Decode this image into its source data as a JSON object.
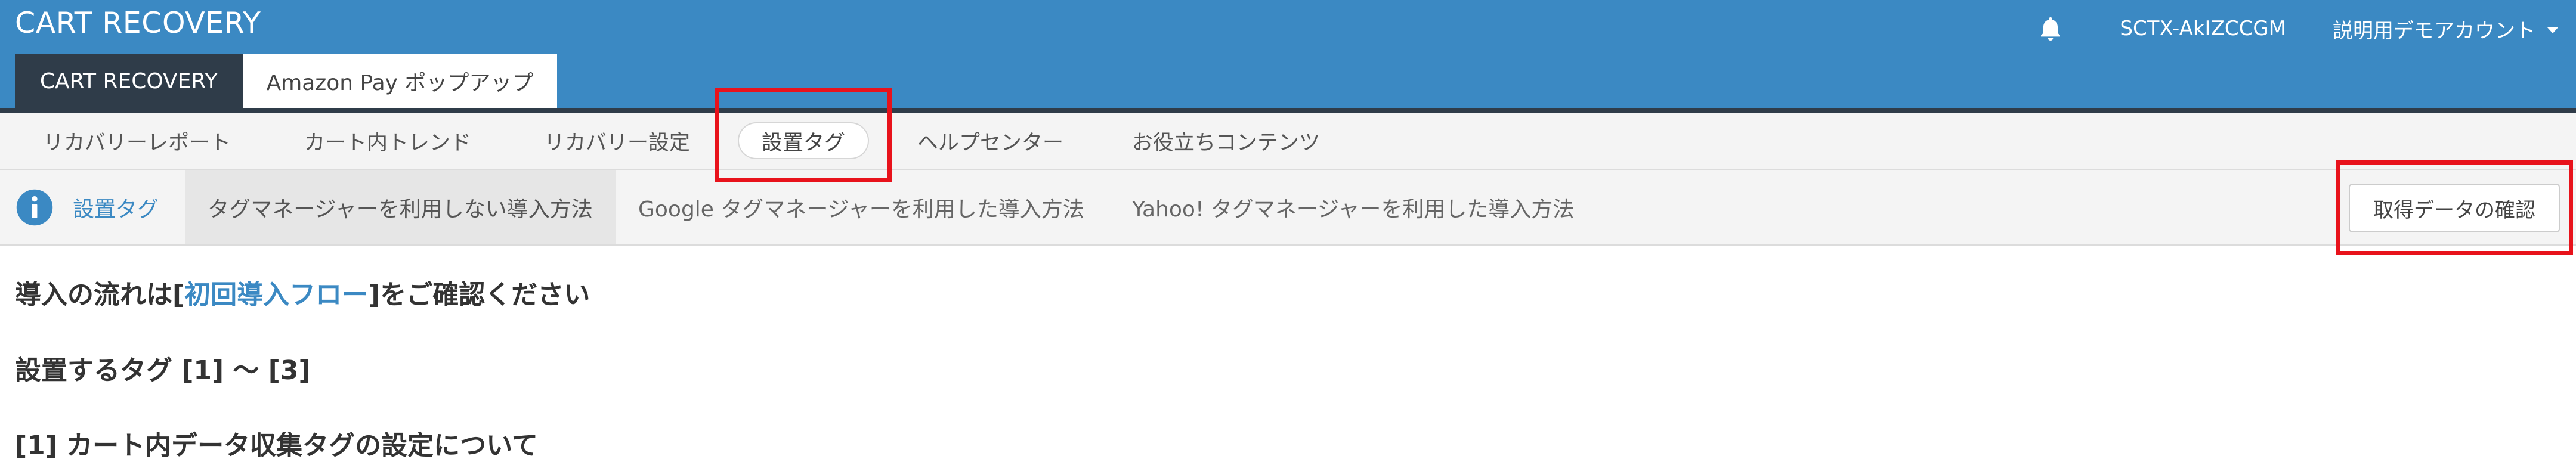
{
  "header": {
    "logo": "CART RECOVERY",
    "account_id": "SCTX-AkIZCCGM",
    "account_name": "説明用デモアカウント"
  },
  "top_tabs": [
    {
      "label": "CART RECOVERY",
      "active": true
    },
    {
      "label": "Amazon Pay ポップアップ",
      "active": false
    }
  ],
  "subnav": {
    "items": [
      {
        "label": "リカバリーレポート"
      },
      {
        "label": "カート内トレンド"
      },
      {
        "label": "リカバリー設定"
      },
      {
        "label": "設置タグ",
        "active": true
      },
      {
        "label": "ヘルプセンター"
      },
      {
        "label": "お役立ちコンテンツ"
      }
    ]
  },
  "infobar": {
    "label": "設置タグ",
    "methods": [
      {
        "label": "タグマネージャーを利用しない導入方法",
        "active": true
      },
      {
        "label": "Google タグマネージャーを利用した導入方法"
      },
      {
        "label": "Yahoo! タグマネージャーを利用した導入方法"
      }
    ],
    "confirm_button": "取得データの確認"
  },
  "content": {
    "flow_prefix": "導入の流れは[",
    "flow_link": "初回導入フロー",
    "flow_suffix": "]をご確認ください",
    "tags_heading": "設置するタグ [1] ～ [3]",
    "section_1_heading": "[1] カート内データ収集タグの設定について"
  },
  "colors": {
    "header_blue": "#3b89c3",
    "dark_navy": "#2f3c49",
    "highlight_red": "#e8121b",
    "link_blue": "#3b89c3"
  },
  "icons": {
    "notification": "bell-icon",
    "account_menu": "caret-down-icon",
    "info": "info-circle-icon"
  }
}
